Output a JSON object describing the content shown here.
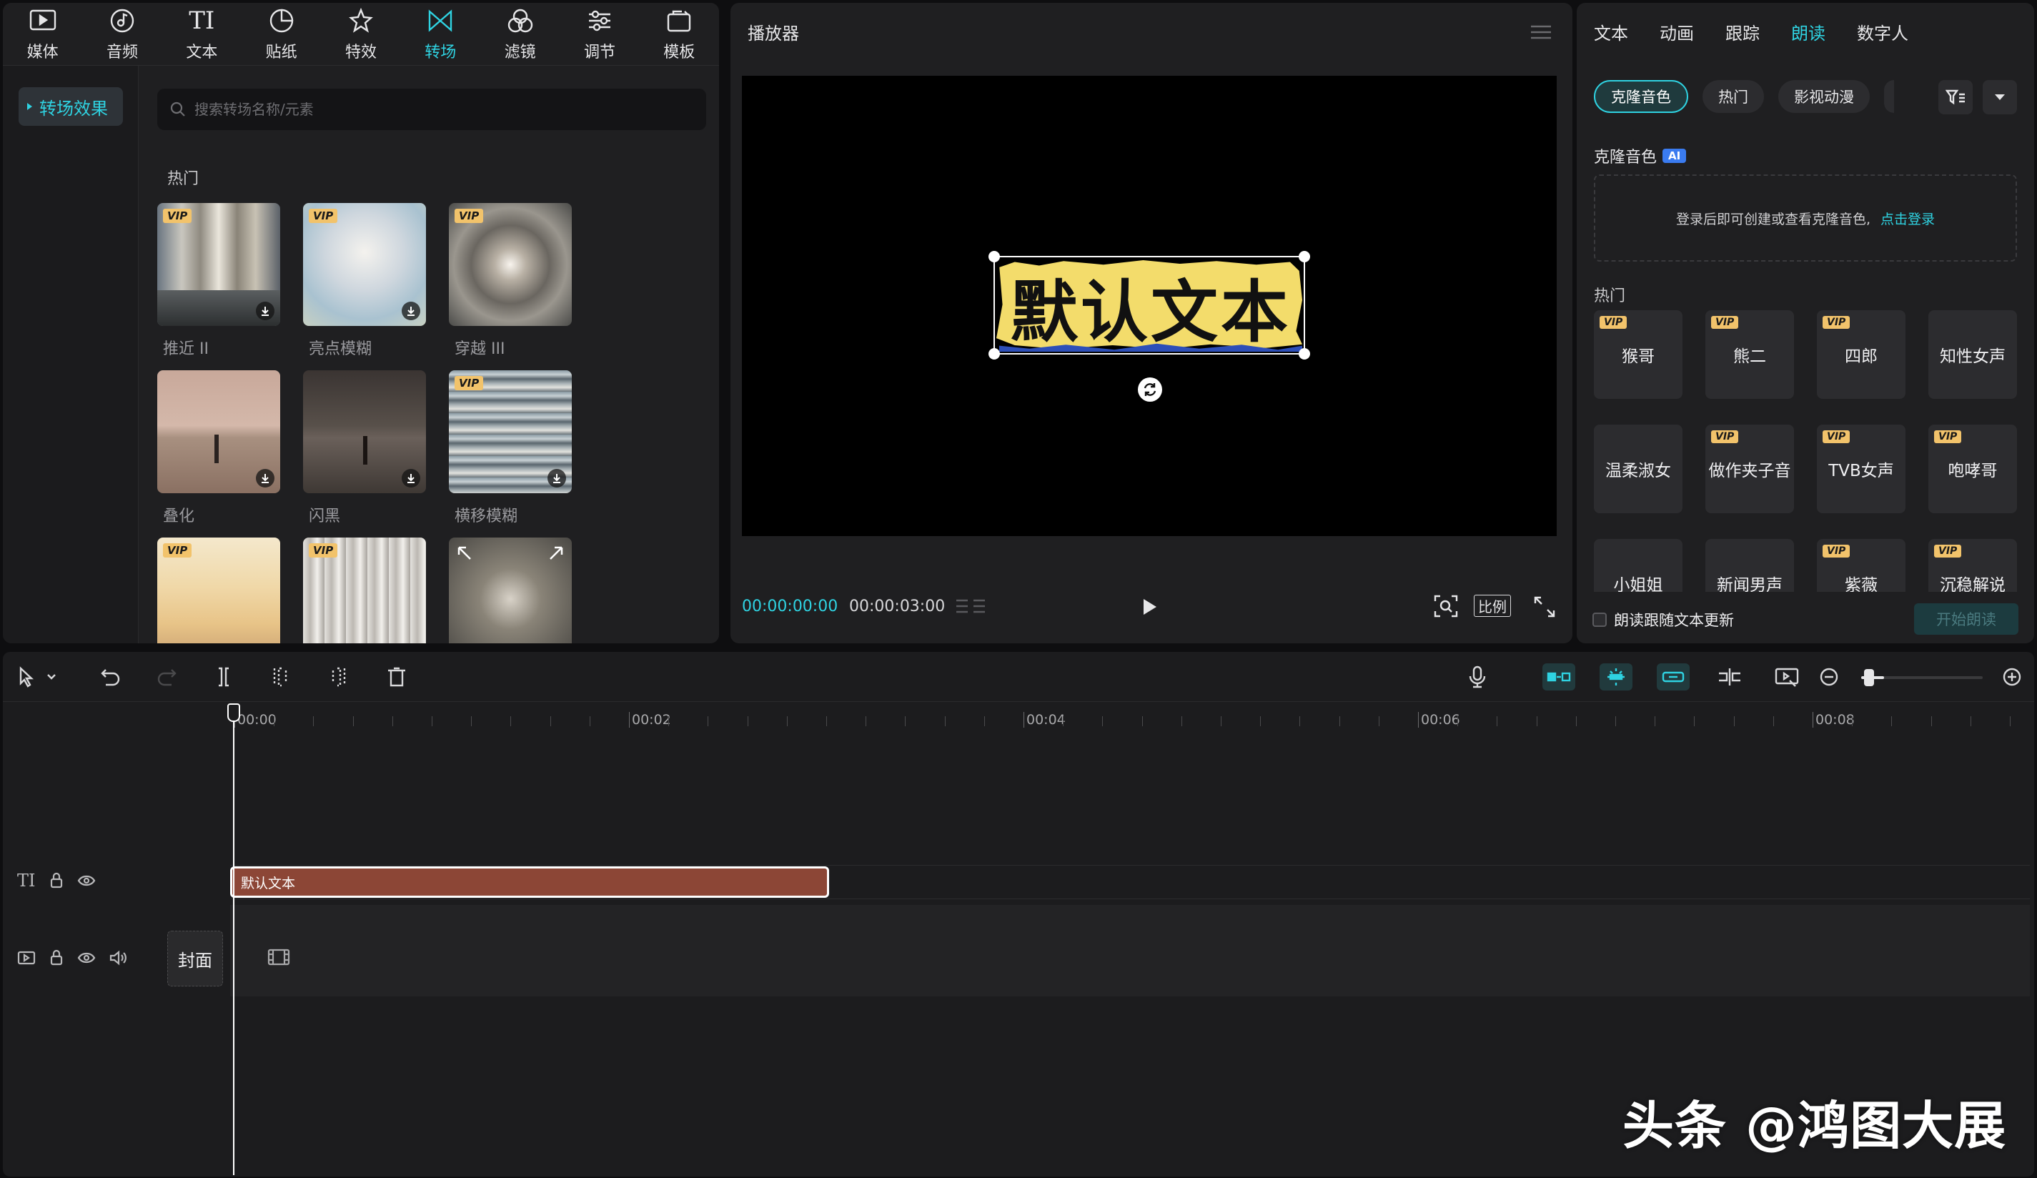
{
  "toolbar": {
    "items": [
      {
        "label": "媒体",
        "icon": "media-icon"
      },
      {
        "label": "音频",
        "icon": "audio-icon"
      },
      {
        "label": "文本",
        "icon": "text-icon"
      },
      {
        "label": "贴纸",
        "icon": "sticker-icon"
      },
      {
        "label": "特效",
        "icon": "effects-icon"
      },
      {
        "label": "转场",
        "icon": "transition-icon",
        "active": true
      },
      {
        "label": "滤镜",
        "icon": "filter-icon"
      },
      {
        "label": "调节",
        "icon": "adjust-icon"
      },
      {
        "label": "模板",
        "icon": "template-icon"
      }
    ]
  },
  "sidebar": {
    "active_item": "转场效果"
  },
  "search": {
    "placeholder": "搜索转场名称/元素"
  },
  "transitions": {
    "section_title": "热门",
    "items": [
      {
        "name": "推近 II",
        "vip": true
      },
      {
        "name": "亮点模糊",
        "vip": true
      },
      {
        "name": "穿越 III",
        "vip": true
      },
      {
        "name": "叠化",
        "vip": false
      },
      {
        "name": "闪黑",
        "vip": false
      },
      {
        "name": "横移模糊",
        "vip": true
      },
      {
        "name": "",
        "vip": true
      },
      {
        "name": "",
        "vip": true
      },
      {
        "name": "",
        "vip": false
      }
    ],
    "vip_label": "VIP"
  },
  "player": {
    "title": "播放器",
    "canvas_text": "默认文本",
    "current_time": "00:00:00:00",
    "total_time": "00:00:03:00",
    "ratio_label": "比例"
  },
  "reading": {
    "tabs": [
      {
        "label": "文本"
      },
      {
        "label": "动画"
      },
      {
        "label": "跟踪"
      },
      {
        "label": "朗读",
        "active": true
      },
      {
        "label": "数字人"
      }
    ],
    "chips": [
      "克隆音色",
      "热门",
      "影视动漫"
    ],
    "clone_title": "克隆音色",
    "ai_badge": "AI",
    "clone_message": "登录后即可创建或查看克隆音色,",
    "login_link": "点击登录",
    "hot_title": "热门",
    "voices": [
      {
        "name": "猴哥",
        "vip": true
      },
      {
        "name": "熊二",
        "vip": true
      },
      {
        "name": "四郎",
        "vip": true
      },
      {
        "name": "知性女声",
        "vip": false
      },
      {
        "name": "温柔淑女",
        "vip": false
      },
      {
        "name": "做作夹子音",
        "vip": true
      },
      {
        "name": "TVB女声",
        "vip": true
      },
      {
        "name": "咆哮哥",
        "vip": true
      },
      {
        "name": "小姐姐",
        "vip": false
      },
      {
        "name": "新闻男声",
        "vip": false
      },
      {
        "name": "紫薇",
        "vip": true
      },
      {
        "name": "沉稳解说",
        "vip": true
      }
    ],
    "follow_label": "朗读跟随文本更新",
    "start_button": "开始朗读"
  },
  "timeline": {
    "ruler_labels": [
      "00:00",
      "00:02",
      "00:04",
      "00:06",
      "00:08"
    ],
    "text_clip_label": "默认文本",
    "cover_label": "封面"
  },
  "watermark": "头条 @鸿图大展",
  "colors": {
    "accent": "#2fd3e2",
    "vip_badge": "#f2c36b",
    "text_clip": "#8c4636",
    "panel": "#1f1f21"
  }
}
